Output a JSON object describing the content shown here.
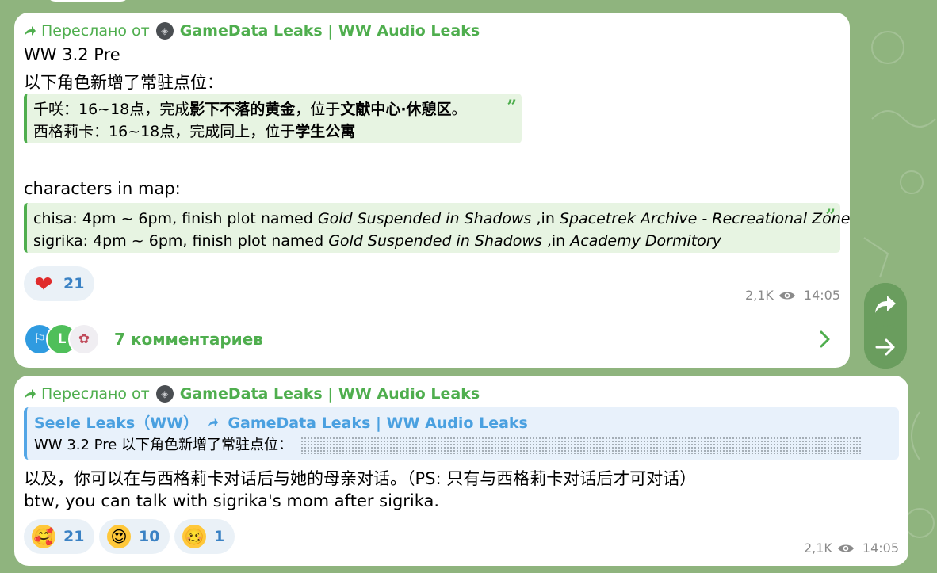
{
  "forward_prefix": "Переслано от",
  "source_channel": "GameData Leaks | WW Audio Leaks",
  "message1": {
    "title": "WW 3.2 Pre",
    "intro_cn": "以下角色新增了常驻点位：",
    "quote_cn": {
      "line1_a": "千咲：16~18点，完成",
      "line1_b": "影下不落的黄金",
      "line1_c": "，位于",
      "line1_d": "文献中心·休憩区",
      "line1_e": "。",
      "line2_a": "西格莉卡：16~18点，完成同上，位于",
      "line2_b": "学生公寓"
    },
    "heading_en": "characters in map:",
    "quote_en": {
      "line1_a": "chisa: 4pm ~ 6pm, finish plot named ",
      "line1_b": "Gold Suspended in Shadows",
      "line1_c": " ,in ",
      "line1_d": "Spacetrek Archive - Recreational Zone",
      "line2_a": "sigrika: 4pm ~ 6pm, finish plot named ",
      "line2_b": "Gold Suspended in Shadows",
      "line2_c": " ,in ",
      "line2_d": "Academy Dormitory"
    },
    "reaction": {
      "emoji": "❤",
      "count": "21"
    },
    "views": "2,1K",
    "time": "14:05",
    "comments_label": "7 комментариев",
    "comment_avatars": [
      {
        "letter": "",
        "color": "#2f9be0"
      },
      {
        "letter": "L",
        "color": "#4fbf5a"
      },
      {
        "letter": "",
        "color": "#f0eef2"
      }
    ]
  },
  "message2": {
    "nested_header_a": "Seele Leaks（WW）",
    "nested_header_b": "GameData Leaks | WW Audio Leaks",
    "nested_body": "WW 3.2 Pre 以下角色新增了常驻点位：",
    "text_cn": "以及，你可以在与西格莉卡对话后与她的母亲对话。（PS: 只有与西格莉卡对话后才可对话）",
    "text_en": "btw, you can talk with sigrika's mom after sigrika.",
    "reactions": [
      {
        "emoji": "🥰",
        "count": "21"
      },
      {
        "emoji": "😍",
        "count": "10"
      },
      {
        "emoji": "🥴",
        "count": "1"
      }
    ],
    "views": "2,1K",
    "time": "14:05"
  },
  "colors": {
    "accent_green": "#4fae4e",
    "link_blue": "#4aa0e0",
    "background": "#8fb47e"
  }
}
